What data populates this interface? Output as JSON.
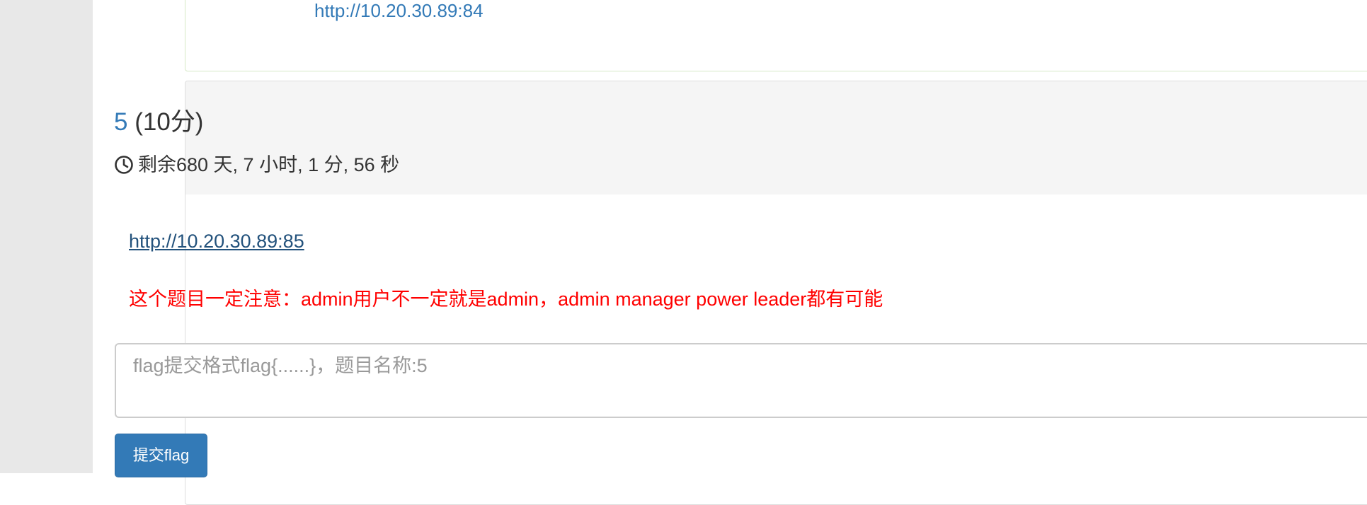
{
  "previous_panel": {
    "link_text": "http://10.20.30.89:84"
  },
  "challenge": {
    "number": "5",
    "points": "(10分)",
    "timer_text": "剩余680 天, 7 小时, 1 分, 56 秒",
    "timer_icon": "clock-icon",
    "link_text": "http://10.20.30.89:85",
    "notice": "这个题目一定注意：admin用户不一定就是admin，admin manager power leader都有可能",
    "flag_input": {
      "value": "",
      "placeholder": "flag提交格式flag{......}，题目名称:5"
    },
    "submit_label": "提交flag"
  },
  "colors": {
    "link": "#337ab7",
    "link_visited": "#23527c",
    "notice": "#ff0000",
    "button_bg": "#337ab7",
    "panel_heading_bg": "#f5f5f5",
    "success_border": "#d6e9c6",
    "gutter_bg": "#e8e8e8"
  }
}
